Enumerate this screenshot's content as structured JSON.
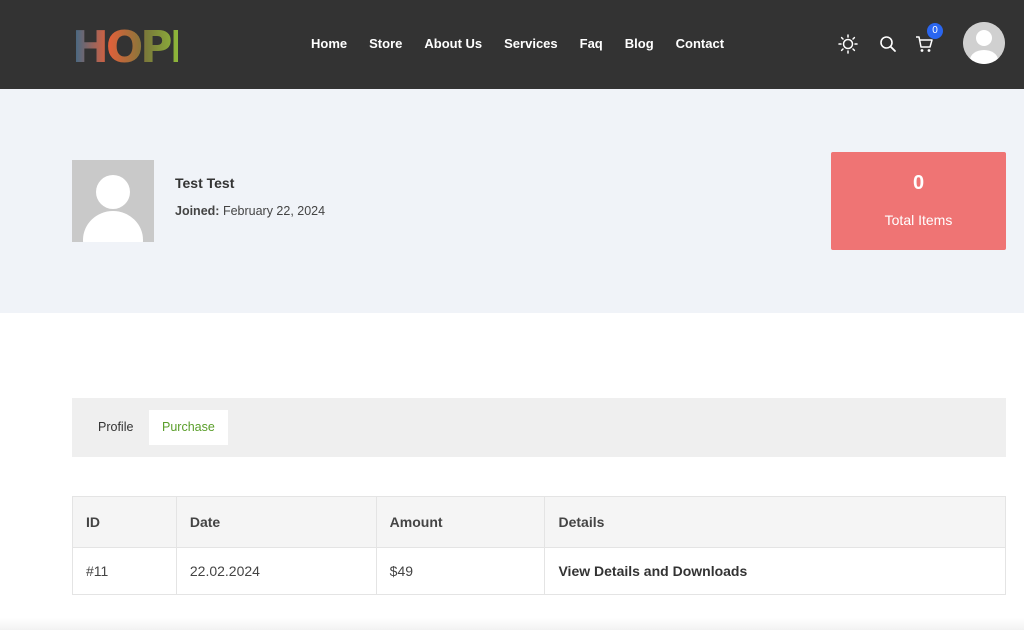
{
  "header": {
    "logo_text": "HOPE",
    "nav": [
      "Home",
      "Store",
      "About Us",
      "Services",
      "Faq",
      "Blog",
      "Contact"
    ],
    "cart_count": "0",
    "icons": [
      "sun-icon",
      "search-icon",
      "cart-icon",
      "user-avatar-icon"
    ]
  },
  "profile": {
    "name": "Test Test",
    "joined_label": "Joined:",
    "joined_date": "February 22, 2024"
  },
  "stats": {
    "total_items_value": "0",
    "total_items_label": "Total Items",
    "card_color": "#ef7474"
  },
  "tabs": {
    "items": [
      "Profile",
      "Purchase"
    ],
    "active": "Purchase",
    "active_color": "#5a9e2a"
  },
  "purchases": {
    "columns": [
      "ID",
      "Date",
      "Amount",
      "Details"
    ],
    "rows": [
      {
        "id": "#11",
        "date": "22.02.2024",
        "amount": "$49",
        "details": "View Details and Downloads"
      }
    ]
  }
}
